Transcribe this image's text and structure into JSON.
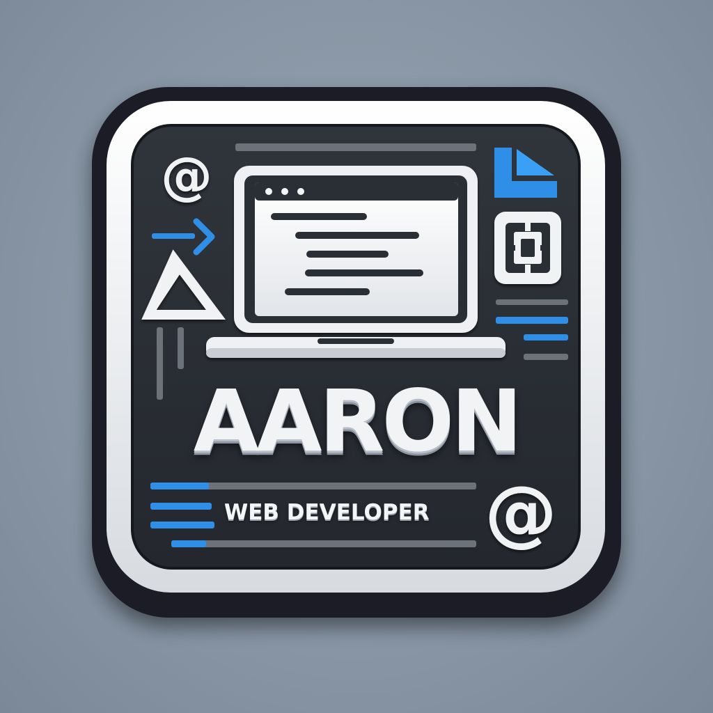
{
  "logo": {
    "name": "AARON",
    "tagline": "WEB DEVELOPER"
  },
  "colors": {
    "background": "#8a97a6",
    "frame_dark": "#1c2027",
    "frame_light": "#f1f2f4",
    "panel": "#2a2e35",
    "accent_blue": "#2f8fe6",
    "bar_gray": "#6e737b"
  },
  "icons": [
    "at-sign-icon",
    "arrow-right-icon",
    "triangle-icon",
    "laptop-icon",
    "code-window-icon",
    "corner-bracket-icon",
    "chip-icon",
    "at-sign-icon"
  ]
}
